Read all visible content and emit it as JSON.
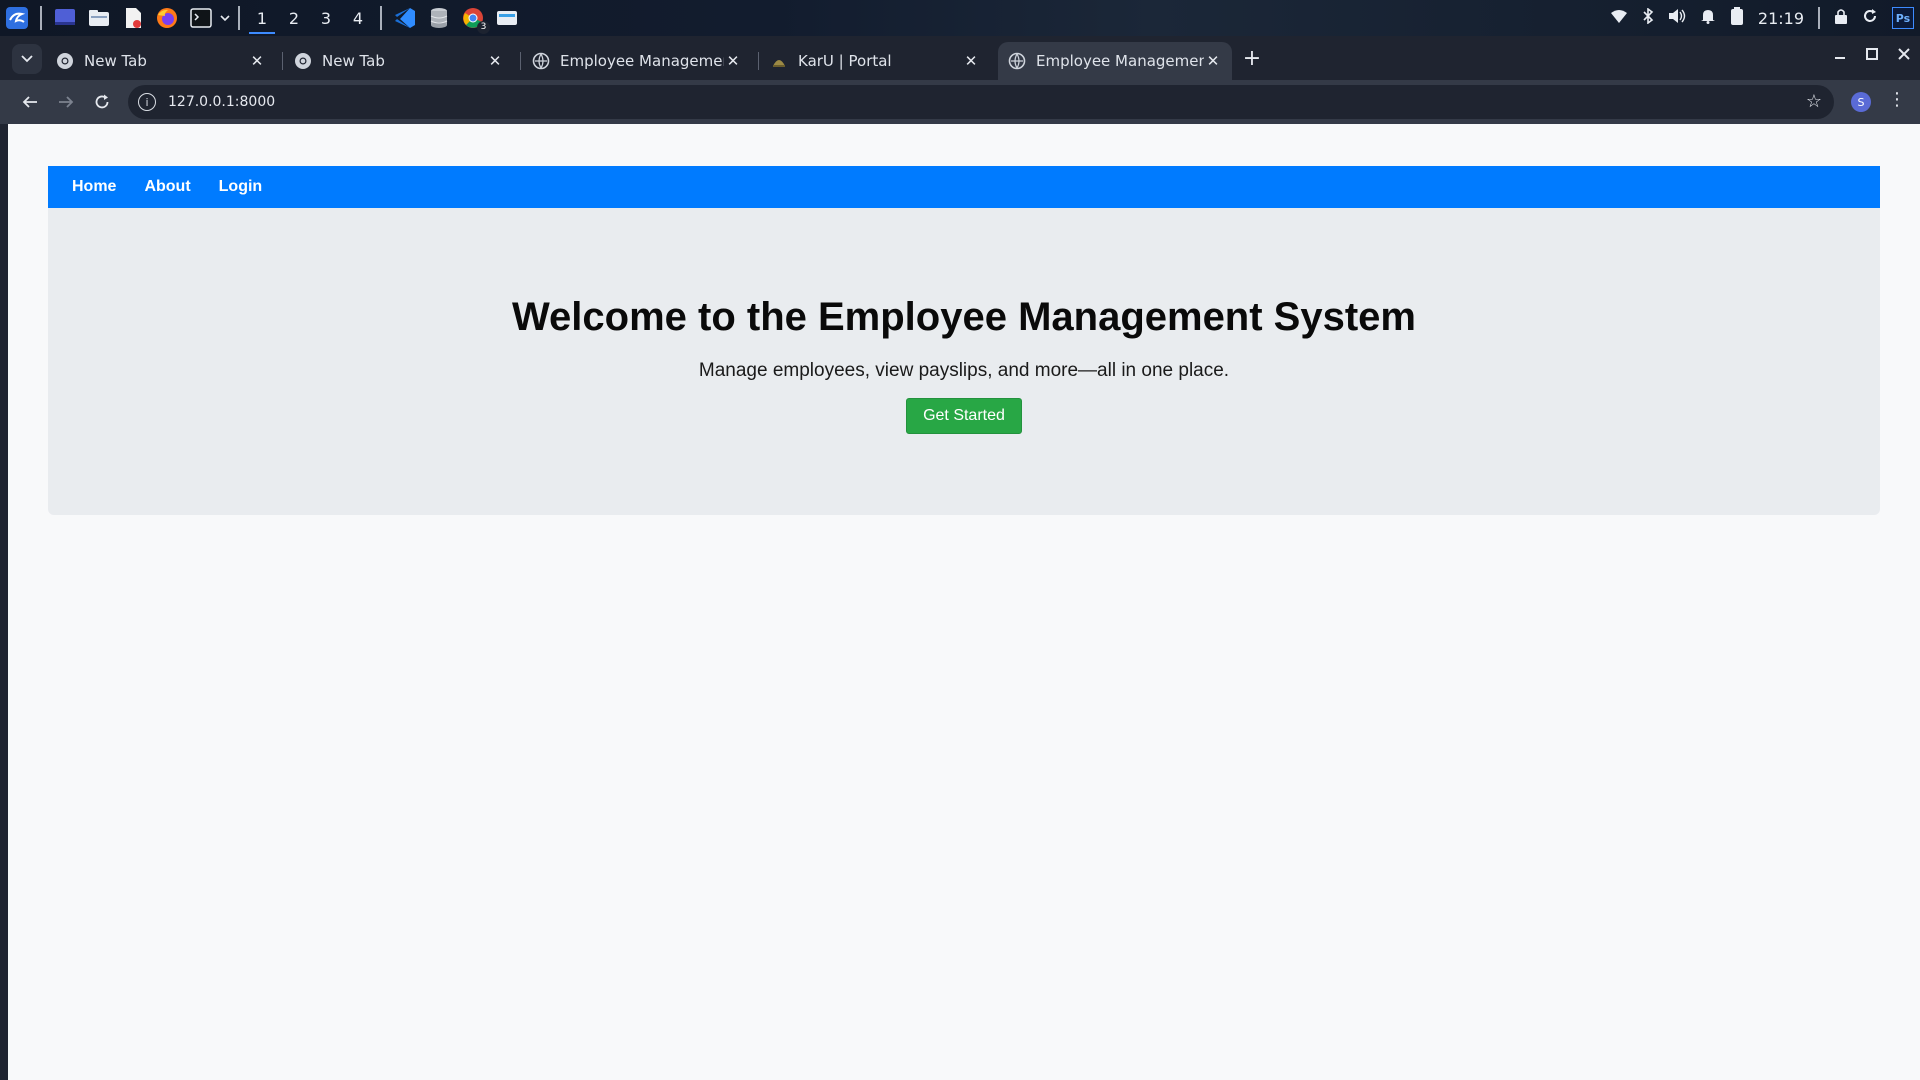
{
  "taskbar": {
    "workspaces": [
      "1",
      "2",
      "3",
      "4"
    ],
    "active_workspace": "1",
    "chrome_badge": "3",
    "clock": "21:19",
    "tray_icons": [
      "wifi-icon",
      "bluetooth-icon",
      "volume-icon",
      "bell-icon",
      "battery-icon",
      "lock-icon",
      "refresh-icon",
      "photoshop-icon"
    ],
    "ps_label": "Ps"
  },
  "browser": {
    "tabs": [
      {
        "title": "New Tab"
      },
      {
        "title": "New Tab"
      },
      {
        "title": "Employee Management S"
      },
      {
        "title": "KarU | Portal"
      },
      {
        "title": "Employee Management S"
      }
    ],
    "active_tab": 4,
    "url": "127.0.0.1:8000",
    "profile_initial": "S"
  },
  "page": {
    "nav": {
      "home": "Home",
      "about": "About",
      "login": "Login"
    },
    "hero": {
      "title": "Welcome to the Employee Management System",
      "subtitle": "Manage employees, view payslips, and more—all in one place.",
      "cta": "Get Started"
    }
  },
  "colors": {
    "nav_bg": "#007bff",
    "hero_bg": "#e9ecef",
    "cta_bg": "#28a745",
    "page_bg": "#f8f9fa"
  }
}
